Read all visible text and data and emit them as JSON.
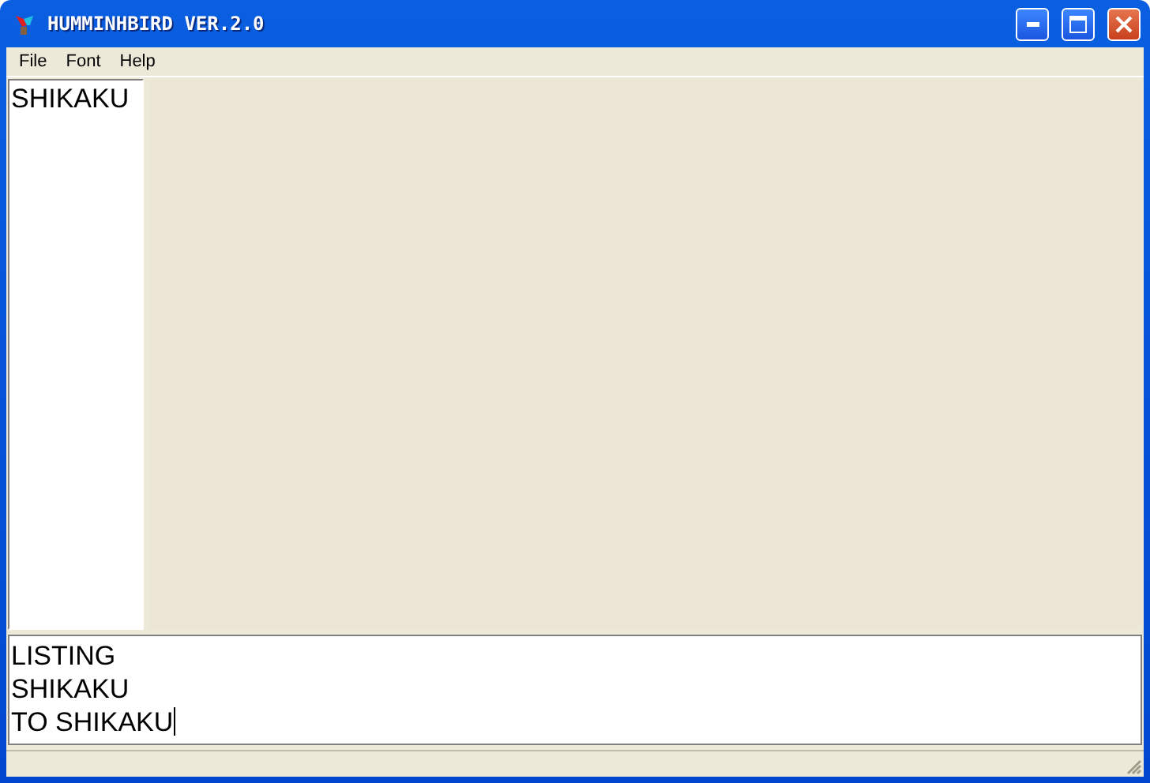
{
  "window": {
    "title": "HUMMINHBIRD VER.2.0"
  },
  "menu": [
    {
      "label": "File"
    },
    {
      "label": "Font"
    },
    {
      "label": "Help"
    }
  ],
  "procedures": [
    {
      "label": "SHIKAKU"
    }
  ],
  "console": {
    "lines": [
      "LISTING",
      "SHIKAKU",
      "TO SHIKAKU"
    ]
  }
}
